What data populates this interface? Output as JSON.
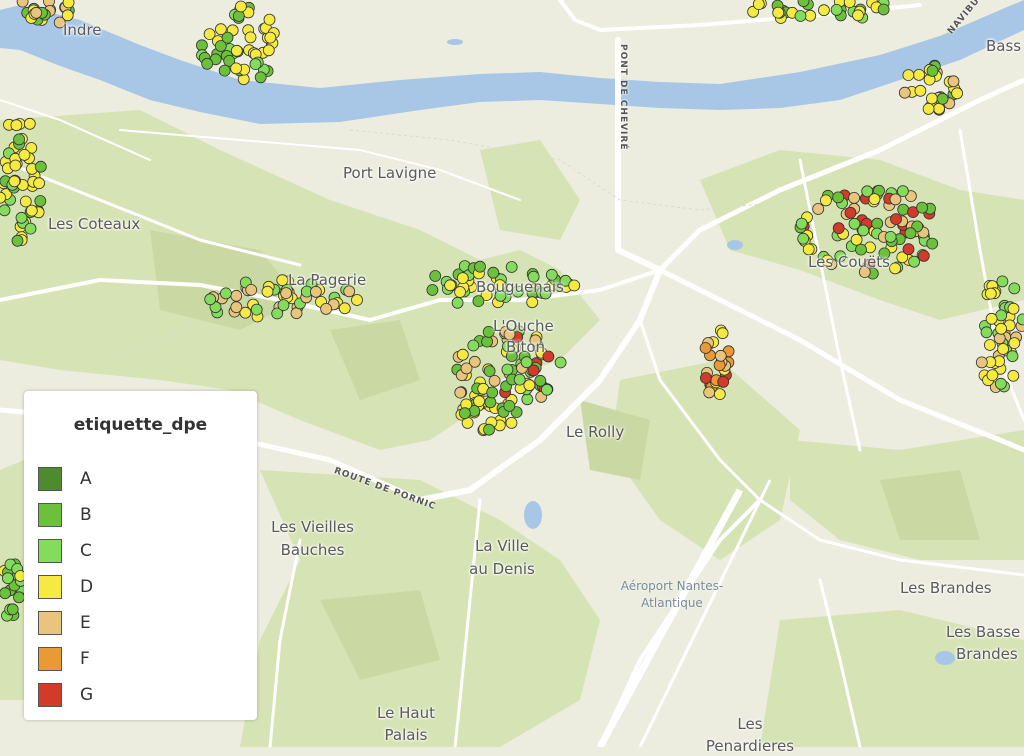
{
  "map": {
    "places": [
      "Indre",
      "Port Lavigne",
      "Les Coteaux",
      "La Pagerie",
      "Bouguenais",
      "L'Ouche",
      "Biton",
      "Le Rolly",
      "Les Couëts",
      "Les Vieilles",
      "Bauches",
      "La Ville",
      "au Denis",
      "Les Brandes",
      "Les Basse",
      "Brandes",
      "Le Haut",
      "Palais",
      "Les",
      "Penardieres",
      "Bass"
    ],
    "roads": [
      "PONT DE CHEVIRÉ",
      "ROUTE DE PORNIC",
      "NAVIBU"
    ],
    "poi": [
      "Aéroport Nantes-",
      "Atlantique"
    ]
  },
  "legend": {
    "title": "etiquette_dpe",
    "items": [
      {
        "label": "A",
        "color": "#4e8a2e"
      },
      {
        "label": "B",
        "color": "#6cc13c"
      },
      {
        "label": "C",
        "color": "#84dc5c"
      },
      {
        "label": "D",
        "color": "#f5ea42"
      },
      {
        "label": "E",
        "color": "#e9c47c"
      },
      {
        "label": "F",
        "color": "#e99a35"
      },
      {
        "label": "G",
        "color": "#d23a2a"
      }
    ]
  },
  "colors": {
    "land": "#ececdf",
    "water": "#a8c7e6",
    "green": "#d6e3b5",
    "road": "#ffffff"
  }
}
